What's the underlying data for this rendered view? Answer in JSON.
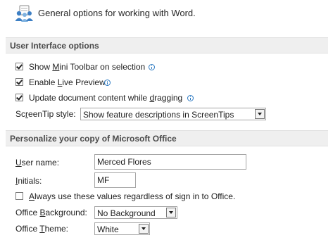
{
  "header": {
    "text": "General options for working with Word."
  },
  "ui_options": {
    "section_title": "User Interface options",
    "mini_toolbar": {
      "pre": "Show ",
      "accel": "M",
      "post": "ini Toolbar on selection",
      "checked": true
    },
    "live_preview": {
      "pre": "Enable ",
      "accel": "L",
      "post": "ive Preview",
      "checked": true
    },
    "update_dragging": {
      "pre": "Update document content while ",
      "accel": "d",
      "post": "ragging",
      "checked": true
    },
    "screentip": {
      "label_pre": "Sc",
      "label_accel": "r",
      "label_post": "eenTip style:",
      "value": "Show feature descriptions in ScreenTips"
    }
  },
  "personalize": {
    "section_title": "Personalize your copy of Microsoft Office",
    "username": {
      "label_accel": "U",
      "label_post": "ser name:",
      "value": "Merced Flores"
    },
    "initials": {
      "label_accel": "I",
      "label_post": "nitials:",
      "value": "MF"
    },
    "always_use": {
      "accel": "A",
      "post": "lways use these values regardless of sign in to Office.",
      "checked": false
    },
    "background": {
      "label_pre": "Office ",
      "label_accel": "B",
      "label_post": "ackground:",
      "value": "No Background"
    },
    "theme": {
      "label_pre": "Office ",
      "label_accel": "T",
      "label_post": "heme:",
      "value": "White"
    }
  },
  "icons": {
    "header": "general-options-icon",
    "info": "info-icon",
    "dropdown": "chevron-down-icon"
  },
  "colors": {
    "section_bg": "#efefef",
    "info_blue": "#2b79c2"
  }
}
